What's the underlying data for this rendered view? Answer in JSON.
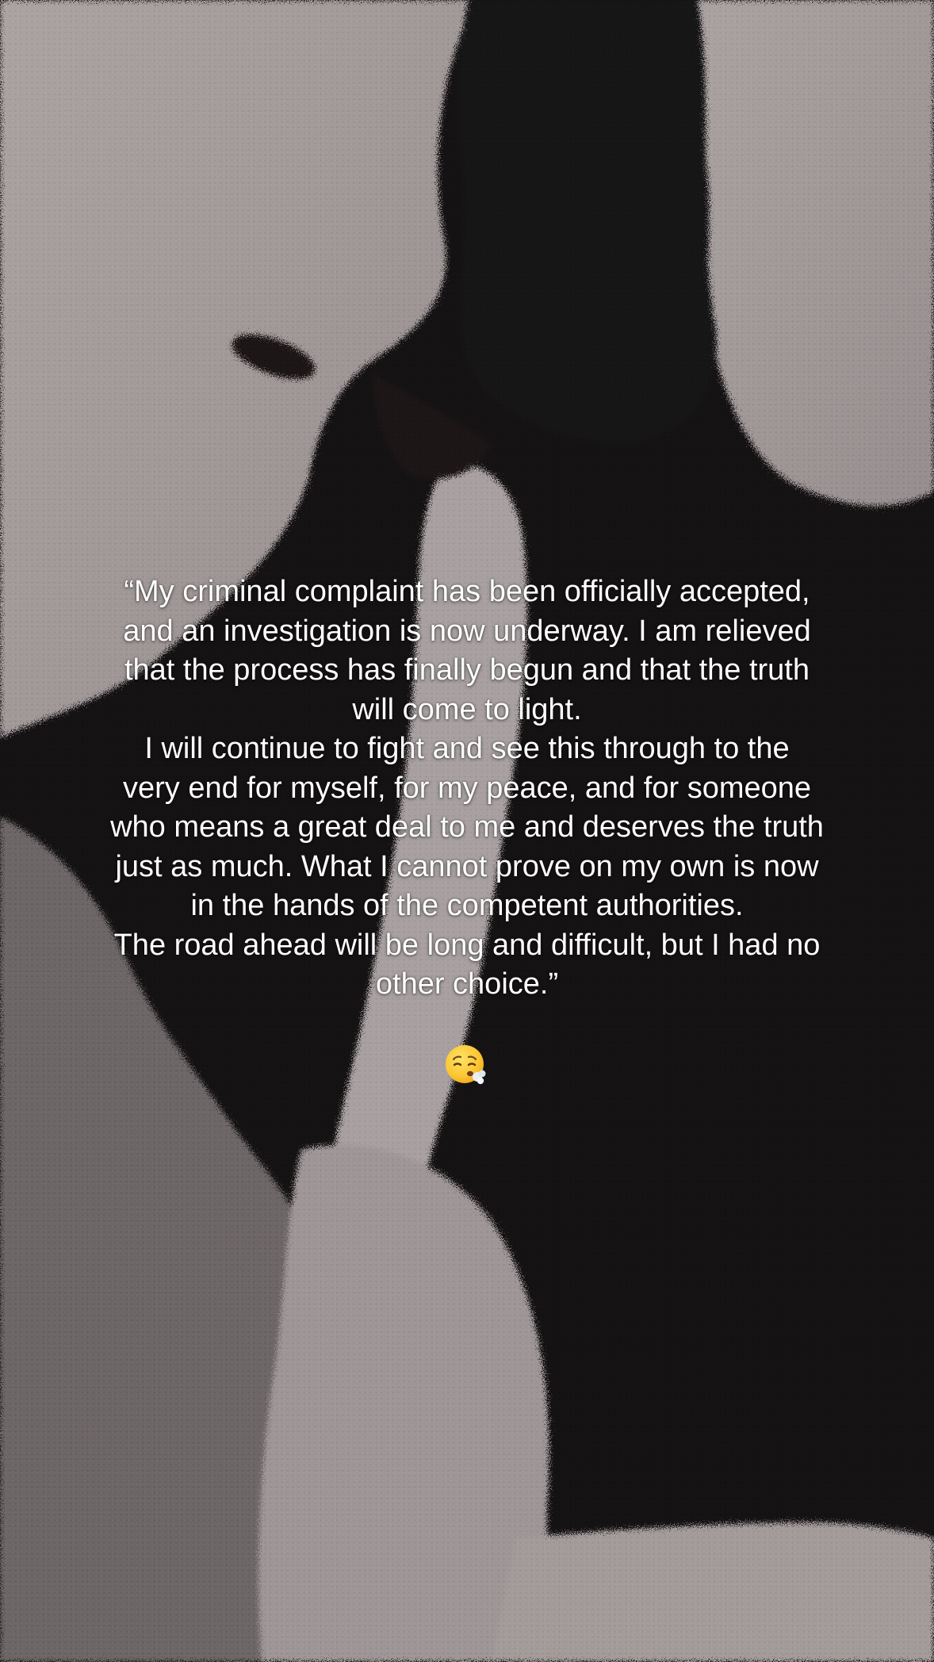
{
  "story": {
    "caption_lines": [
      "“My criminal complaint has been officially accepted,",
      "and an investigation is now underway. I am relieved",
      "that the process has finally begun and that the truth",
      "will come to light.",
      "I will continue to fight and see this through to the",
      "very end for myself, for my peace, and for someone",
      "who means a great deal to me and deserves the truth",
      "just as much. What I cannot prove on my own is now",
      "in the hands of the competent authorities.",
      "The road ahead will be long and difficult, but I had no",
      "other choice.”"
    ],
    "emoji_icon": "face-exhaling-icon"
  },
  "colors": {
    "text": "#ffffff",
    "shadow_dark": "#151214",
    "light_area": "#a59c9c"
  }
}
